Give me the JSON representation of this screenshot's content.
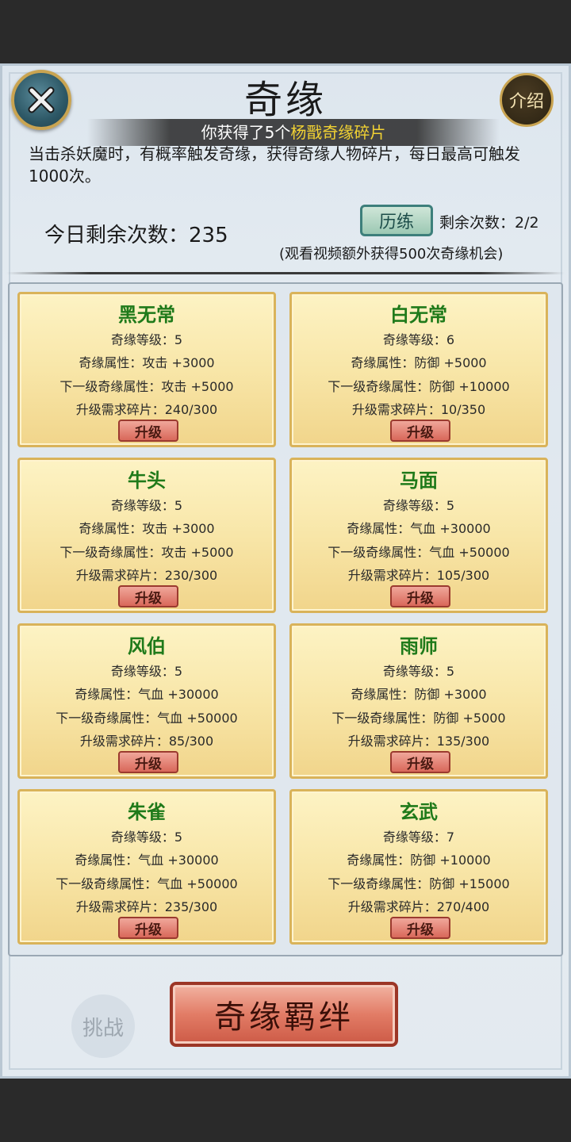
{
  "header": {
    "title": "奇缘",
    "intro_label": "介绍"
  },
  "toast": {
    "prefix": "你获得了5个",
    "highlight": "杨戬奇缘碎片"
  },
  "description": "当击杀妖魔时，有概率触发奇缘，获得奇缘人物碎片，每日最高可触发1000次。",
  "stats": {
    "remaining_today": "今日剩余次数：235",
    "train_label": "历练",
    "times_left": "剩余次数：2/2",
    "video_note": "(观看视频额外获得500次奇缘机会)"
  },
  "cards": [
    {
      "name": "黑无常",
      "level": "奇缘等级：5",
      "attr": "奇缘属性：攻击 +3000",
      "next": "下一级奇缘属性：攻击 +5000",
      "need": "升级需求碎片：240/300",
      "button": "升级"
    },
    {
      "name": "白无常",
      "level": "奇缘等级：6",
      "attr": "奇缘属性：防御 +5000",
      "next": "下一级奇缘属性：防御 +10000",
      "need": "升级需求碎片：10/350",
      "button": "升级"
    },
    {
      "name": "牛头",
      "level": "奇缘等级：5",
      "attr": "奇缘属性：攻击 +3000",
      "next": "下一级奇缘属性：攻击 +5000",
      "need": "升级需求碎片：230/300",
      "button": "升级"
    },
    {
      "name": "马面",
      "level": "奇缘等级：5",
      "attr": "奇缘属性：气血 +30000",
      "next": "下一级奇缘属性：气血 +50000",
      "need": "升级需求碎片：105/300",
      "button": "升级"
    },
    {
      "name": "风伯",
      "level": "奇缘等级：5",
      "attr": "奇缘属性：气血 +30000",
      "next": "下一级奇缘属性：气血 +50000",
      "need": "升级需求碎片：85/300",
      "button": "升级"
    },
    {
      "name": "雨师",
      "level": "奇缘等级：5",
      "attr": "奇缘属性：防御 +3000",
      "next": "下一级奇缘属性：防御 +5000",
      "need": "升级需求碎片：135/300",
      "button": "升级"
    },
    {
      "name": "朱雀",
      "level": "奇缘等级：5",
      "attr": "奇缘属性：气血 +30000",
      "next": "下一级奇缘属性：气血 +50000",
      "need": "升级需求碎片：235/300",
      "button": "升级"
    },
    {
      "name": "玄武",
      "level": "奇缘等级：7",
      "attr": "奇缘属性：防御 +10000",
      "next": "下一级奇缘属性：防御 +15000",
      "need": "升级需求碎片：270/400",
      "button": "升级"
    }
  ],
  "footer": {
    "bond_label": "奇缘羁绊",
    "challenge_label": "挑战"
  },
  "icons": {
    "close": "close-icon"
  }
}
